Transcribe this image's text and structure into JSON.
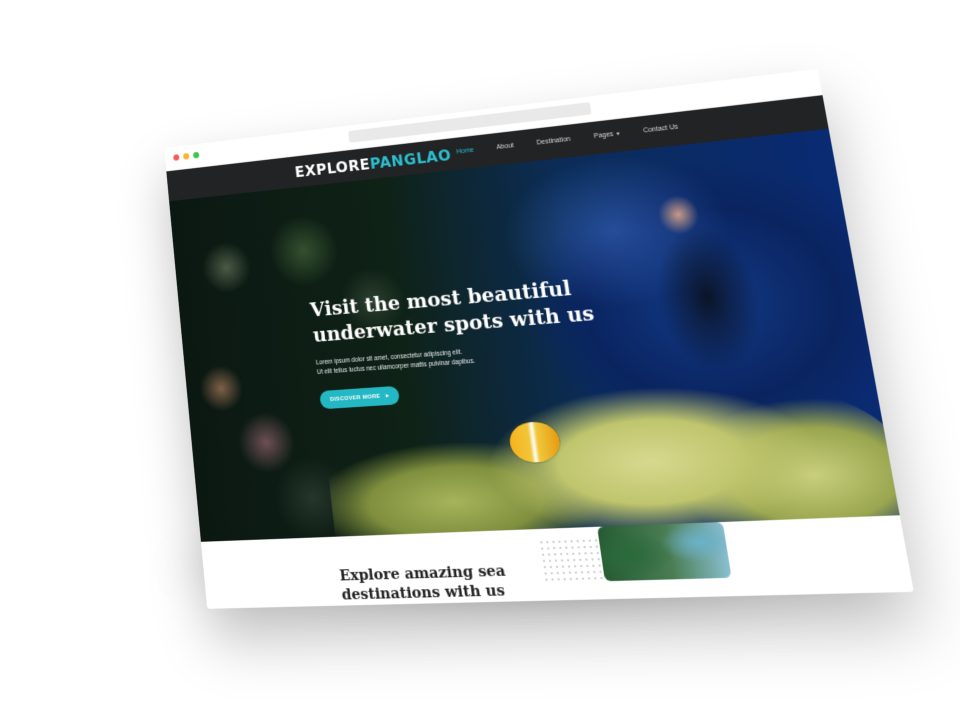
{
  "logo": {
    "text_main": "EXPLORE",
    "text_accent": "PANGLAO"
  },
  "nav": {
    "items": [
      {
        "label": "Home"
      },
      {
        "label": "About"
      },
      {
        "label": "Destination"
      },
      {
        "label": "Pages"
      },
      {
        "label": "Contact Us"
      }
    ],
    "active_index": 0
  },
  "hero": {
    "title_line1": "Visit the most beautiful",
    "title_line2": "underwater spots with us",
    "text_line1": "Lorem ipsum dolor sit amet, consectetur adipiscing elit.",
    "text_line2": "Ut elit tellus luctus nec ullamcorper mattis pulvinar dapibus.",
    "button_label": "DISCOVER MORE"
  },
  "section": {
    "title_line1": "Explore amazing sea",
    "title_line2": "destinations with us"
  },
  "icons": {
    "arrow": "caret-right-icon",
    "dropdown": "chevron-down-icon"
  },
  "colors": {
    "accent": "#24b8c4",
    "nav_bg": "#222325",
    "window_dot_red": "#f45b5b",
    "window_dot_yellow": "#f7b52c",
    "window_dot_green": "#3ec44a"
  }
}
